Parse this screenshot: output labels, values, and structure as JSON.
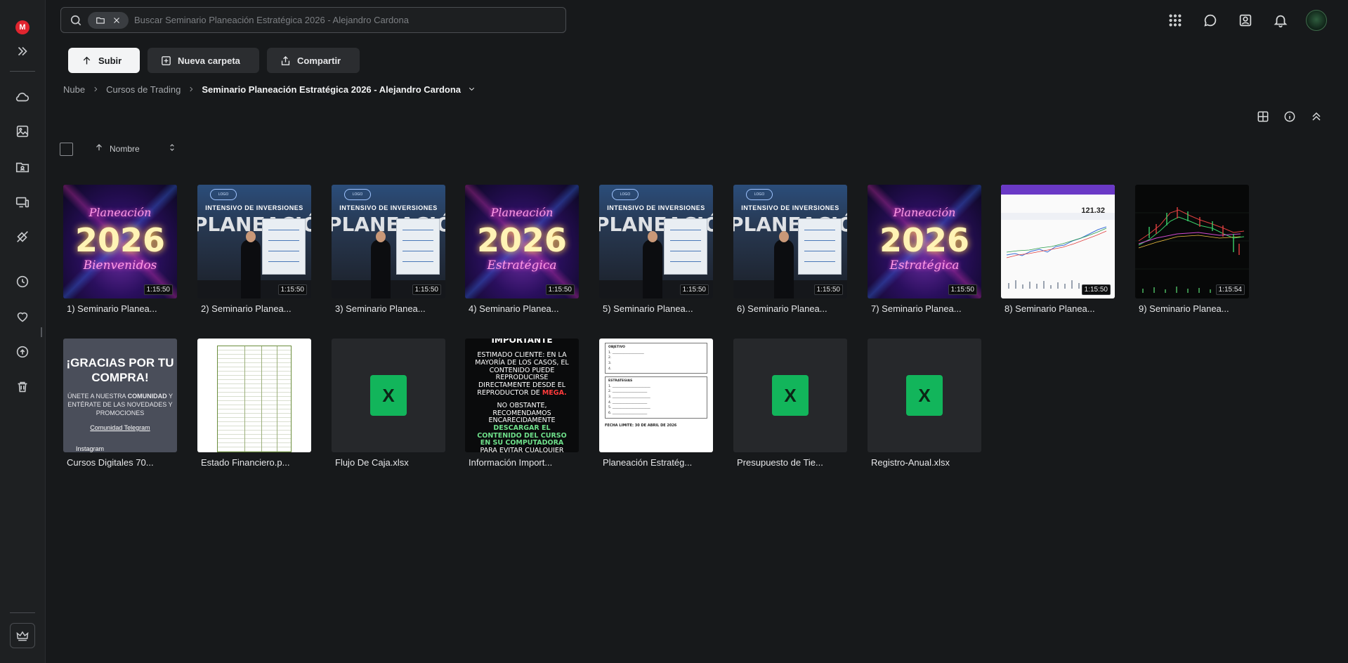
{
  "app": {
    "logo_letter": "M"
  },
  "search": {
    "placeholder": "Buscar Seminario Planeación Estratégica 2026 - Alejandro Cardona"
  },
  "toolbar": {
    "upload_label": "Subir",
    "new_folder_label": "Nueva carpeta",
    "share_label": "Compartir"
  },
  "breadcrumb": {
    "items": [
      "Nube",
      "Cursos de Trading"
    ],
    "current": "Seminario Planeación Estratégica 2026 - Alejandro Cardona"
  },
  "sort": {
    "label": "Nombre"
  },
  "files": [
    {
      "name": "1) Seminario Planea...",
      "duration": "1:15:50"
    },
    {
      "name": "2) Seminario Planea...",
      "duration": "1:15:50"
    },
    {
      "name": "3) Seminario Planea...",
      "duration": "1:15:50"
    },
    {
      "name": "4) Seminario Planea...",
      "duration": "1:15:50"
    },
    {
      "name": "5) Seminario Planea...",
      "duration": "1:15:50"
    },
    {
      "name": "6) Seminario Planea...",
      "duration": "1:15:50"
    },
    {
      "name": "7) Seminario Planea...",
      "duration": "1:15:50"
    },
    {
      "name": "8) Seminario Planea...",
      "duration": "1:15:50"
    },
    {
      "name": "9) Seminario Planea...",
      "duration": "1:15:54"
    },
    {
      "name": "Cursos Digitales 70..."
    },
    {
      "name": "Estado Financiero.p..."
    },
    {
      "name": "Flujo De Caja.xlsx"
    },
    {
      "name": "Información Import..."
    },
    {
      "name": "Planeación Estratég..."
    },
    {
      "name": "Presupuesto de Tie..."
    },
    {
      "name": "Registro-Anual.xlsx"
    }
  ],
  "thumbs": {
    "neon_year": "2026",
    "neon_script_top": "Planeación",
    "neon_script_1": "Bienvenidos",
    "neon_script_4": "Estratégica",
    "seminar_banner": "INTENSIVO DE INVERSIONES",
    "seminar_big": "PLANEACIÓN",
    "chart_price": "121.32",
    "xlsx_letter": "X",
    "thanks_title": "¡GRACIAS POR TU COMPRA!",
    "thanks_body_1": "ÚNETE A NUESTRA",
    "thanks_body_bold": "COMUNIDAD",
    "thanks_body_2": "Y ENTÉRATE DE LAS NOVEDADES Y PROMOCIONES",
    "thanks_link": "Comunidad Telegram",
    "thanks_link2": "Instagram",
    "important_title": "IMPORTANTE",
    "important_p1": "ESTIMADO CLIENTE: EN LA MAYORÍA DE LOS CASOS, EL CONTENIDO PUEDE REPRODUCIRSE DIRECTAMENTE DESDE EL REPRODUCTOR DE",
    "important_mega": "MEGA.",
    "important_p2": "NO OBSTANTE, RECOMENDAMOS ENCARECIDAMENTE",
    "important_green": "DESCARGAR EL CONTENIDO DEL CURSO EN SU COMPUTADORA",
    "important_p3": "PARA EVITAR CUALQUIER INCONVENIENTE O EVENTUALIDAD EN EL ACCESO.",
    "plan_objetivo": "OBJETIVO",
    "plan_estrategias": "ESTRATEGIAS",
    "plan_fecha": "FECHA LIMITE: 30 DE ABRIL DE 2026"
  }
}
